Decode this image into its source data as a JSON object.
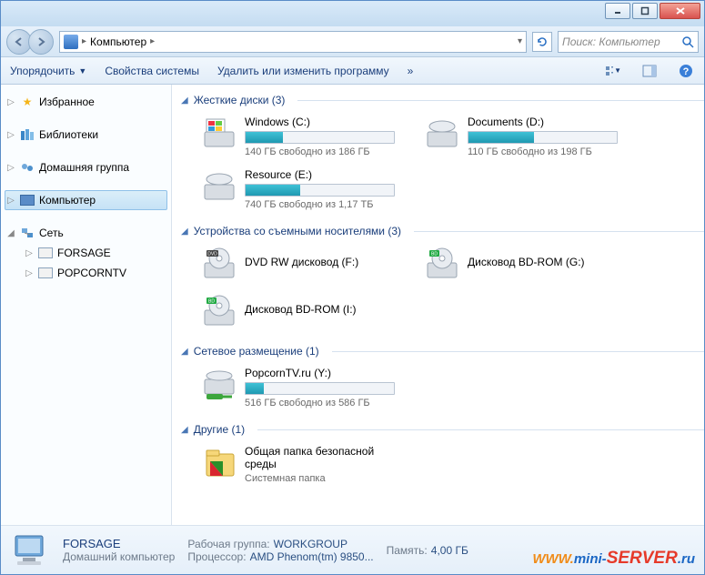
{
  "address": {
    "location": "Компьютер"
  },
  "search": {
    "placeholder": "Поиск: Компьютер"
  },
  "toolbar": {
    "organize": "Упорядочить",
    "system_props": "Свойства системы",
    "uninstall": "Удалить или изменить программу",
    "more": "»"
  },
  "sidebar": {
    "favorites": "Избранное",
    "libraries": "Библиотеки",
    "homegroup": "Домашняя группа",
    "computer": "Компьютер",
    "network": "Сеть",
    "net_nodes": [
      "FORSAGE",
      "POPCORNTV"
    ]
  },
  "groups": {
    "hdd": {
      "label": "Жесткие диски (3)"
    },
    "removable": {
      "label": "Устройства со съемными носителями (3)"
    },
    "netloc": {
      "label": "Сетевое размещение (1)"
    },
    "other": {
      "label": "Другие (1)"
    }
  },
  "drives": {
    "c": {
      "name": "Windows (C:)",
      "space": "140 ГБ свободно из 186 ГБ",
      "pct": 25
    },
    "d": {
      "name": "Documents (D:)",
      "space": "110 ГБ свободно из 198 ГБ",
      "pct": 44
    },
    "e": {
      "name": "Resource (E:)",
      "space": "740 ГБ свободно из 1,17 ТБ",
      "pct": 37
    },
    "f": {
      "name": "DVD RW дисковод (F:)"
    },
    "g": {
      "name": "Дисковод BD-ROM (G:)"
    },
    "i": {
      "name": "Дисковод BD-ROM (I:)"
    },
    "y": {
      "name": "PopcornTV.ru (Y:)",
      "space": "516 ГБ свободно из 586 ГБ",
      "pct": 12
    }
  },
  "other_item": {
    "name": "Общая папка безопасной среды",
    "sub": "Системная папка"
  },
  "status": {
    "name": "FORSAGE",
    "type": "Домашний компьютер",
    "workgroup_lbl": "Рабочая группа:",
    "workgroup": "WORKGROUP",
    "cpu_lbl": "Процессор:",
    "cpu": "AMD Phenom(tm) 9850...",
    "mem_lbl": "Память:",
    "mem": "4,00 ГБ"
  },
  "watermark": {
    "w1": "WWW.",
    "w2": "mini-",
    "w3": "SERVER",
    "w4": ".ru"
  }
}
